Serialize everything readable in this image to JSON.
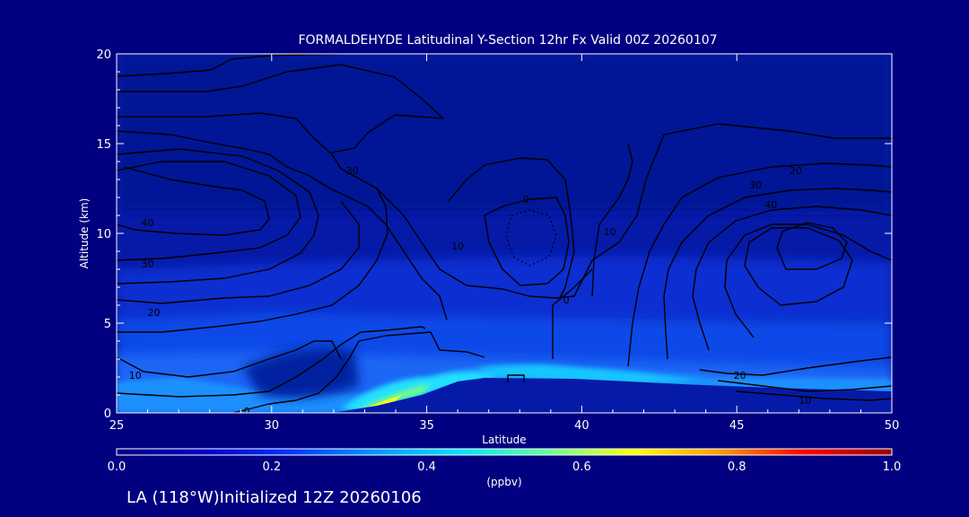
{
  "chart_data": {
    "type": "heatmap",
    "title": "FORMALDEHYDE Latitudinal Y-Section 12hr  Fx Valid 00Z 20260107",
    "xlabel": "Latitude",
    "ylabel": "Altitude (km)",
    "xlim": [
      25,
      50
    ],
    "ylim": [
      0,
      20
    ],
    "x_ticks": [
      "25",
      "30",
      "35",
      "40",
      "45",
      "50"
    ],
    "y_ticks": [
      "0",
      "5",
      "10",
      "15",
      "20"
    ],
    "colorbar": {
      "ticks": [
        "0.0",
        "0.2",
        "0.4",
        "0.6",
        "0.8",
        "1.0"
      ],
      "range": [
        0,
        1
      ],
      "unit_label": "(ppbv)",
      "colors": [
        "#000080",
        "#0000c8",
        "#0033ff",
        "#0099ff",
        "#00e5ff",
        "#66ff99",
        "#ffff00",
        "#ff9900",
        "#ff0000",
        "#990000"
      ]
    },
    "contour_labels": [
      {
        "text": "40",
        "lat": 26.0,
        "alt": 10.6
      },
      {
        "text": "30",
        "lat": 26.0,
        "alt": 8.3
      },
      {
        "text": "20",
        "lat": 26.2,
        "alt": 5.6
      },
      {
        "text": "10",
        "lat": 25.6,
        "alt": 2.1
      },
      {
        "text": "0",
        "lat": 29.2,
        "alt": 0.1
      },
      {
        "text": "30",
        "lat": 32.6,
        "alt": 13.5
      },
      {
        "text": "10",
        "lat": 36.0,
        "alt": 9.3
      },
      {
        "text": "0",
        "lat": 38.2,
        "alt": 11.9
      },
      {
        "text": "0",
        "lat": 39.5,
        "alt": 6.3
      },
      {
        "text": "10",
        "lat": 40.9,
        "alt": 10.1
      },
      {
        "text": "20",
        "lat": 46.9,
        "alt": 13.5
      },
      {
        "text": "30",
        "lat": 45.6,
        "alt": 12.7
      },
      {
        "text": "40",
        "lat": 46.1,
        "alt": 11.6
      },
      {
        "text": "20",
        "lat": 45.1,
        "alt": 2.1
      },
      {
        "text": "10",
        "lat": 47.2,
        "alt": 0.7
      }
    ]
  },
  "footer": {
    "text": "LA (118°W)Initialized 12Z 20260106"
  }
}
